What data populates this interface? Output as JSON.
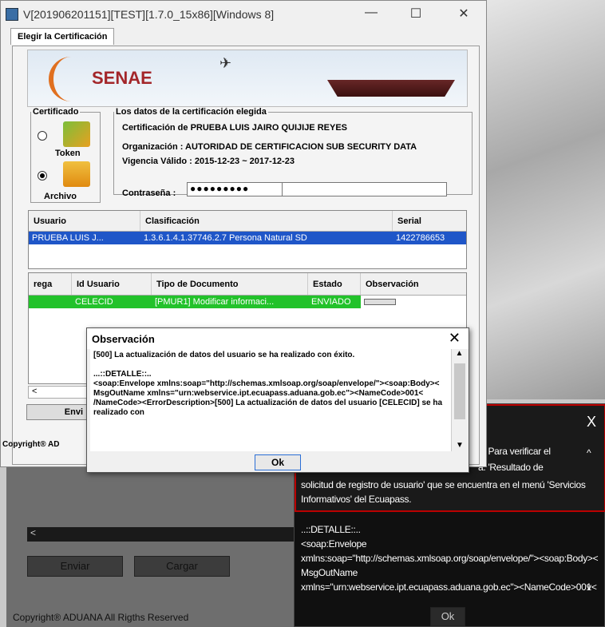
{
  "window": {
    "title": "V[201906201151][TEST][1.7.0_15x86][Windows 8]",
    "min": "—",
    "max": "☐",
    "close": "✕"
  },
  "tab": "Elegir la Certificación",
  "banner": {
    "brand": "SENAE"
  },
  "certificado": {
    "legend": "Certificado",
    "token": "Token",
    "archivo": "Archivo",
    "selected": "archivo"
  },
  "datos": {
    "legend": "Los datos de la certificación elegida",
    "line1": "Certificación de PRUEBA LUIS JAIRO QUIJIJE REYES",
    "line2": "Organización : AUTORIDAD DE CERTIFICACION SUB SECURITY DATA",
    "line3": "Vigencia Válido : 2015-12-23 ~ 2017-12-23",
    "password_label": "Contraseña :",
    "password_value": "●●●●●●●●●"
  },
  "table1": {
    "headers": [
      "Usuario",
      "Clasificación",
      "Serial"
    ],
    "row": [
      "PRUEBA LUIS J...",
      "1.3.6.1.4.1.37746.2.7 Persona Natural SD",
      "1422786653"
    ]
  },
  "table2": {
    "headers": [
      "rega",
      "Id Usuario",
      "Tipo de Documento",
      "Estado",
      "Observación"
    ],
    "row": [
      "",
      "CELECID",
      "[PMUR1] Modificar informaci...",
      "ENVIADO",
      ""
    ]
  },
  "dialog": {
    "title": "Observación",
    "close": "✕",
    "msg1": "[500] La actualización de datos del usuario                        se ha realizado con éxito.",
    "msg2": "...::DETALLE::..",
    "msg3": "<soap:Envelope xmlns:soap=\"http://schemas.xmlsoap.org/soap/envelope/\"><soap:Body>< MsgOutName xmlns=\"urn:webservice.ipt.ecuapass.aduana.gob.ec\"><NameCode>001< /NameCode><ErrorDescription>[500] La actualización de datos del usuario [CELECID] se ha realizado con",
    "ok": "Ok"
  },
  "main_footer": {
    "scroll_left": "<",
    "enviar": "Envi",
    "copyright": "Copyright® AD"
  },
  "background": {
    "enviar": "Enviar",
    "cargar": "Cargar",
    "scroll_left": "<",
    "copyright": "Copyright® ADUANA All Rigths Reserved"
  },
  "bgdialog": {
    "close": "X",
    "t1": "o. Para verificar el",
    "t2": "a: 'Resultado de",
    "t3": "solicitud de registro de usuario' que se encuentra en el menú 'Servicios",
    "t4": "Informativos' del Ecuapass.",
    "t5": "..::DETALLE::..",
    "t6": "<soap:Envelope",
    "t7": "xmlns:soap=\"http://schemas.xmlsoap.org/soap/envelope/\"><soap:Body><",
    "t8": "MsgOutName",
    "t9": "xmlns=\"urn:webservice.ipt.ecuapass.aduana.gob.ec\"><NameCode>001<",
    "ok": "Ok",
    "up": "^",
    "down": "v"
  }
}
